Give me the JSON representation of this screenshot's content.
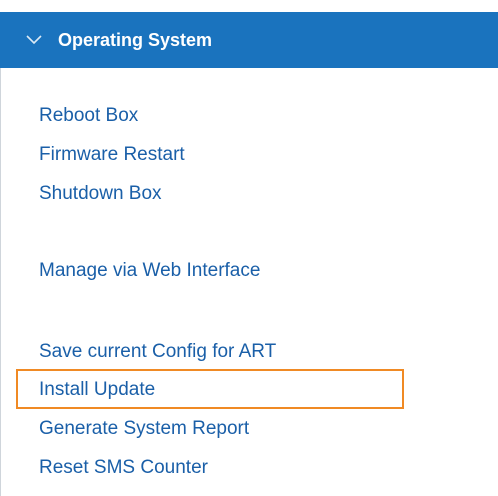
{
  "section": {
    "title": "Operating System",
    "expanded_icon": "chevron-down-icon",
    "header_color": "#1A73BE"
  },
  "menu": {
    "items": [
      {
        "label": "Reboot Box"
      },
      {
        "label": "Firmware Restart"
      },
      {
        "label": "Shutdown Box"
      },
      {
        "label": "Manage via Web Interface"
      },
      {
        "label": "Save current Config for ART"
      },
      {
        "label": "Install Update"
      },
      {
        "label": "Generate System Report"
      },
      {
        "label": "Reset SMS Counter"
      }
    ],
    "link_color": "#1A5FA8",
    "highlight_color": "#F08A24",
    "highlighted_item": "Install Update"
  }
}
